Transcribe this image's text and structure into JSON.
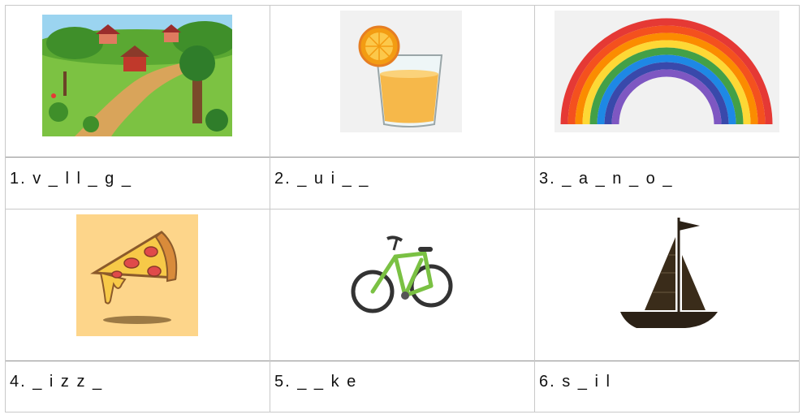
{
  "worksheet": {
    "items": [
      {
        "image": "village-scene",
        "label": "1. v _ l l _ g _"
      },
      {
        "image": "orange-juice-glass",
        "label": "2. _ u i _ _"
      },
      {
        "image": "rainbow",
        "label": "3. _ a _ n _ o _"
      },
      {
        "image": "pizza-slice",
        "label": "4. _ i z z _"
      },
      {
        "image": "bicycle",
        "label": "5. _ _ k e"
      },
      {
        "image": "sailboat",
        "label": "6. s _ i l"
      }
    ]
  }
}
